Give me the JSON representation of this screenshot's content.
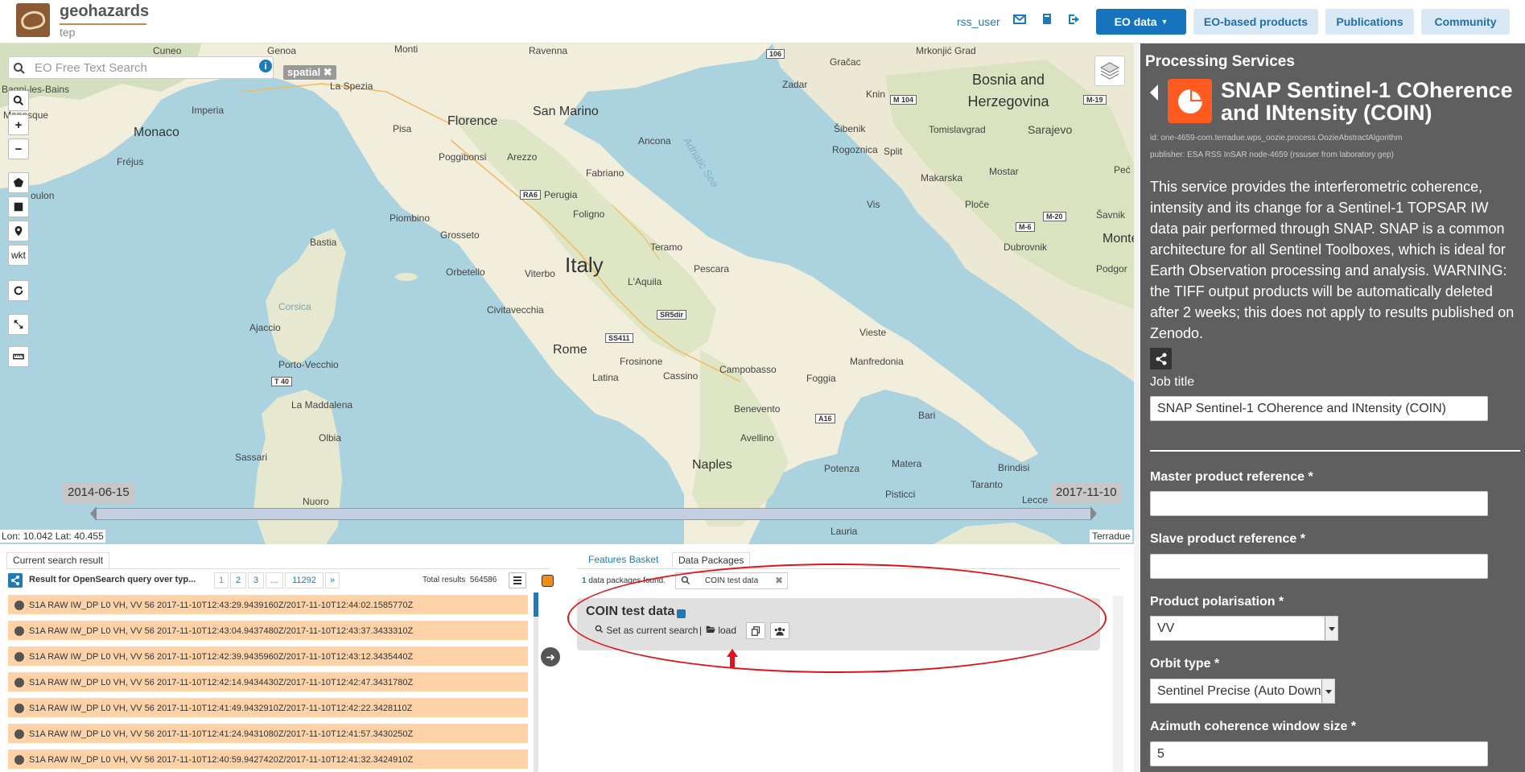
{
  "header": {
    "logo_title": "geohazards",
    "logo_subtitle": "tep",
    "username": "rss_user",
    "icons": [
      "envelope-icon",
      "book-icon",
      "sign-out-icon"
    ],
    "nav": {
      "eo_data": "EO data",
      "eo_products": "EO-based products",
      "publications": "Publications",
      "community": "Community"
    }
  },
  "map": {
    "search_placeholder": "EO Free Text Search",
    "spatial_tag": "spatial",
    "tools": [
      "search-icon",
      "zoom-in",
      "zoom-out",
      "polygon-icon",
      "square-icon",
      "marker-icon",
      "wkt",
      "refresh-icon",
      "expand-icon",
      "ruler-icon"
    ],
    "wkt_label": "wkt",
    "zoom_in": "+",
    "zoom_out": "−",
    "date_start": "2014-06-15",
    "date_end": "2017-11-10",
    "coordinates": "Lon: 10.042 Lat: 40.455",
    "attribution": "Terradue",
    "labels": {
      "cuneo": "Cuneo",
      "genoa": "Genoa",
      "monti": "Monti",
      "ravenna": "Ravenna",
      "gracac": "Gračac",
      "mrkonjic": "Mrkonjić Grad",
      "bosnia": "Bosnia and Herzegovina",
      "bagni": "Bagni-les-Bains",
      "imperia": "Imperia",
      "laspezia": "La Spezia",
      "sanmarino": "San Marino",
      "zadar": "Zadar",
      "knin": "Knin",
      "manosque": "Manosque",
      "monaco": "Monaco",
      "pisa": "Pisa",
      "florence": "Florence",
      "ancona": "Ancona",
      "sibenik": "Šibenik",
      "tomislavgrad": "Tomislavgrad",
      "sarajevo": "Sarajevo",
      "frejus": "Fréjus",
      "poggibonsi": "Poggibonsi",
      "arezzo": "Arezzo",
      "rogoznica": "Rogoznica",
      "split": "Split",
      "pecs": "Peć",
      "fabriano": "Fabriano",
      "makarska": "Makarska",
      "mostar": "Mostar",
      "toulon": "oulon",
      "perugia": "Perugia",
      "foligno": "Foligno",
      "vis": "Vis",
      "ploce": "Ploče",
      "savnik": "Šavnik",
      "piombino": "Piombino",
      "grosseto": "Grosseto",
      "teramo": "Teramo",
      "dubrovnik": "Dubrovnik",
      "montenegro": "Monte",
      "bastia": "Bastia",
      "italy": "Italy",
      "orbetello": "Orbetello",
      "viterbo": "Viterbo",
      "pescara": "Pescara",
      "podgor": "Podgor",
      "laquila": "L'Aquila",
      "civitavecchia": "Civitavecchia",
      "corsica": "Corsica",
      "ajaccio": "Ajaccio",
      "rome": "Rome",
      "vieste": "Vieste",
      "frosinone": "Frosinone",
      "manfredonia": "Manfredonia",
      "portovecchio": "Porto-Vecchio",
      "latina": "Latina",
      "cassino": "Cassino",
      "campobasso": "Campobasso",
      "foggia": "Foggia",
      "lamaddalena": "La Maddalena",
      "benevento": "Benevento",
      "bari": "Bari",
      "olbia": "Olbia",
      "avellino": "Avellino",
      "sassari": "Sassari",
      "naples": "Naples",
      "matera": "Matera",
      "brindisi": "Brindisi",
      "potenza": "Potenza",
      "taranto": "Taranto",
      "nuoro": "Nuoro",
      "pisticci": "Pisticci",
      "lecce": "Lecce",
      "lauria": "Lauria",
      "adriatic": "Adriatic Sea"
    },
    "roads": {
      "r106": "106",
      "m104": "M 104",
      "m19": "M-19",
      "m20": "M-20",
      "m6": "M-6",
      "ra6": "RA6",
      "sr5dir": "SR5dir",
      "ss411": "SS411",
      "t40": "T 40",
      "a16": "A16"
    }
  },
  "results": {
    "tab_label": "Current search result",
    "query_text": "Result for OpenSearch query over typ...",
    "pages": [
      "1",
      "2",
      "3",
      "...",
      "11292",
      "»"
    ],
    "total_label": "Total results",
    "total_value": "564586",
    "items": [
      "S1A RAW IW_DP L0 VH, VV 56 2017-11-10T12:43:29.9439160Z/2017-11-10T12:44:02.1585770Z",
      "S1A RAW IW_DP L0 VH, VV 56 2017-11-10T12:43:04.9437480Z/2017-11-10T12:43:37.3433310Z",
      "S1A RAW IW_DP L0 VH, VV 56 2017-11-10T12:42:39.9435960Z/2017-11-10T12:43:12.3435440Z",
      "S1A RAW IW_DP L0 VH, VV 56 2017-11-10T12:42:14.9434430Z/2017-11-10T12:42:47.3431780Z",
      "S1A RAW IW_DP L0 VH, VV 56 2017-11-10T12:41:49.9432910Z/2017-11-10T12:42:22.3428110Z",
      "S1A RAW IW_DP L0 VH, VV 56 2017-11-10T12:41:24.9431080Z/2017-11-10T12:41:57.3430250Z",
      "S1A RAW IW_DP L0 VH, VV 56 2017-11-10T12:40:59.9427420Z/2017-11-10T12:41:32.3424910Z"
    ]
  },
  "packages": {
    "tab_basket": "Features Basket",
    "tab_packages": "Data Packages",
    "found_count": "1",
    "found_text": "data packages found.",
    "search_value": "COIN test data",
    "package_title": "COIN test data",
    "set_current": "Set as current search",
    "load": "load",
    "separator": "|"
  },
  "service": {
    "panel_title": "Processing Services",
    "title": "SNAP Sentinel-1 COherence and INtensity (COIN)",
    "id": "id: one-4659-com.terradue.wps_oozie.process.OozieAbstractAlgorithm",
    "publisher": "publisher: ESA RSS InSAR node-4659 (rssuser from laboratory gep)",
    "description": "This service provides the interferometric coherence, intensity and its change for a Sentinel-1 TOPSAR IW data pair performed through SNAP. SNAP is a common architecture for all Sentinel Toolboxes, which is ideal for Earth Observation processing and analysis. WARNING: the TIFF output products will be automatically deleted after 2 weeks; this does not apply to results published on Zenodo.",
    "job_title_label": "Job title",
    "job_title_value": "SNAP Sentinel-1 COherence and INtensity (COIN)",
    "master_label": "Master product reference *",
    "master_value": "",
    "slave_label": "Slave product reference *",
    "slave_value": "",
    "polarisation_label": "Product polarisation *",
    "polarisation_value": "VV",
    "orbit_label": "Orbit type *",
    "orbit_value": "Sentinel Precise (Auto Download)",
    "azimuth_label": "Azimuth coherence window size *",
    "azimuth_value": "5"
  },
  "colors": {
    "accent": "#1674bf",
    "panel_bg": "#5f5f5f",
    "result_row": "#ffd2a8",
    "highlight": "#e0141c"
  }
}
